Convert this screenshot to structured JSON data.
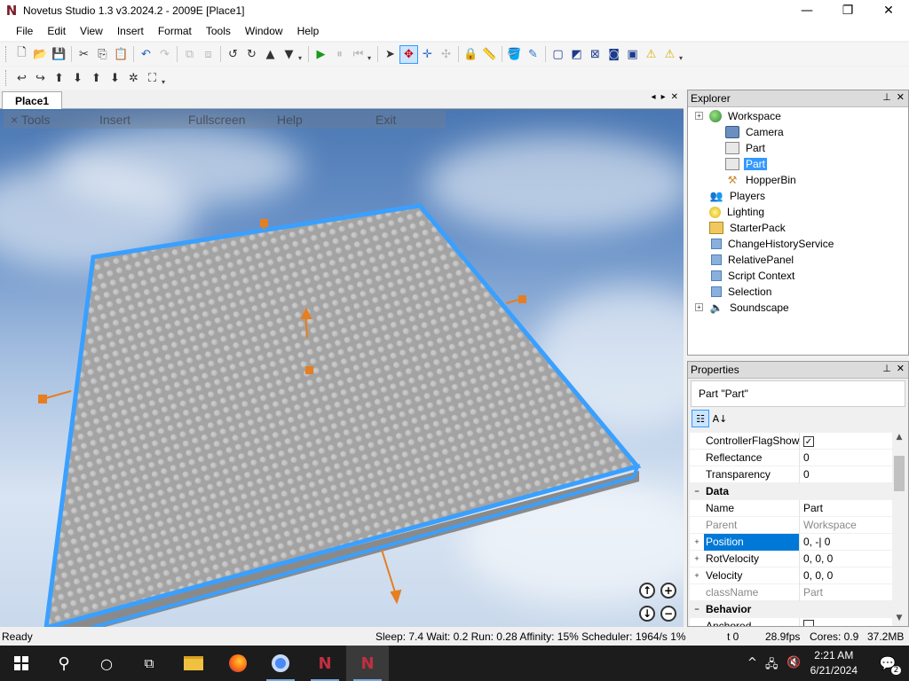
{
  "window": {
    "title": "Novetus Studio 1.3 v3.2024.2 - 2009E [Place1]",
    "logo_letter": "N",
    "minimize": "—",
    "maximize": "❐",
    "close": "✕"
  },
  "menu": [
    "File",
    "Edit",
    "View",
    "Insert",
    "Format",
    "Tools",
    "Window",
    "Help"
  ],
  "document_tab": {
    "label": "Place1",
    "controls": [
      "◂",
      "▸",
      "✕"
    ]
  },
  "game_menu": [
    "× Tools",
    "Insert",
    "Fullscreen",
    "Help",
    "Exit"
  ],
  "explorer": {
    "title": "Explorer",
    "pin": "📌",
    "close": "✕",
    "items": [
      {
        "label": "Workspace",
        "level": 0,
        "expander": "+",
        "icon": "globe-icon",
        "selected": false
      },
      {
        "label": "Camera",
        "level": 1,
        "icon": "camera-icon",
        "selected": false
      },
      {
        "label": "Part",
        "level": 1,
        "icon": "part-icon",
        "selected": false
      },
      {
        "label": "Part",
        "level": 1,
        "icon": "part-icon",
        "selected": true
      },
      {
        "label": "HopperBin",
        "level": 1,
        "icon": "hopperbin-icon",
        "selected": false
      },
      {
        "label": "Players",
        "level": 0,
        "icon": "players-icon",
        "selected": false
      },
      {
        "label": "Lighting",
        "level": 0,
        "icon": "lightbulb-icon",
        "selected": false
      },
      {
        "label": "StarterPack",
        "level": 0,
        "icon": "folder-icon",
        "selected": false
      },
      {
        "label": "ChangeHistoryService",
        "level": 0,
        "icon": "service-icon",
        "selected": false
      },
      {
        "label": "RelativePanel",
        "level": 0,
        "icon": "service-icon",
        "selected": false
      },
      {
        "label": "Script Context",
        "level": 0,
        "icon": "service-icon",
        "selected": false
      },
      {
        "label": "Selection",
        "level": 0,
        "icon": "service-icon",
        "selected": false
      },
      {
        "label": "Soundscape",
        "level": 0,
        "expander": "+",
        "icon": "speaker-icon",
        "selected": false
      }
    ]
  },
  "properties": {
    "title": "Properties",
    "pin": "📌",
    "close": "✕",
    "selected_object": "Part \"Part\"",
    "rows": [
      {
        "name": "ControllerFlagShow",
        "value": "",
        "checkbox": true,
        "checked": true
      },
      {
        "name": "Reflectance",
        "value": "0"
      },
      {
        "name": "Transparency",
        "value": "0"
      },
      {
        "category": "Data",
        "expander": "−"
      },
      {
        "name": "Name",
        "value": "Part"
      },
      {
        "name": "Parent",
        "value": "Workspace",
        "readonly": true
      },
      {
        "name": "Position",
        "value": "0, -| 0",
        "expander": "+",
        "highlight": true
      },
      {
        "name": "RotVelocity",
        "value": "0, 0, 0",
        "expander": "+"
      },
      {
        "name": "Velocity",
        "value": "0, 0, 0",
        "expander": "+"
      },
      {
        "name": "className",
        "value": "Part",
        "readonly": true
      },
      {
        "category": "Behavior",
        "expander": "−"
      },
      {
        "name": "Anchored",
        "value": "",
        "checkbox": true,
        "checked": false
      }
    ]
  },
  "status": {
    "left": "Ready",
    "stats": "Sleep: 7.4 Wait: 0.2 Run: 0.28 Affinity: 15% Scheduler: 1964/s 1%",
    "t": "t 0",
    "fps": "28.9fps",
    "cores": "Cores: 0.9",
    "memory": "37.2MB"
  },
  "taskbar": {
    "time": "2:21 AM",
    "date": "6/21/2024",
    "notifications": "2"
  },
  "colors": {
    "selection_box": "#3aa0ff",
    "handles": "#e67e22",
    "baseplate": "#a3a3a3",
    "accent": "#0078d7"
  }
}
